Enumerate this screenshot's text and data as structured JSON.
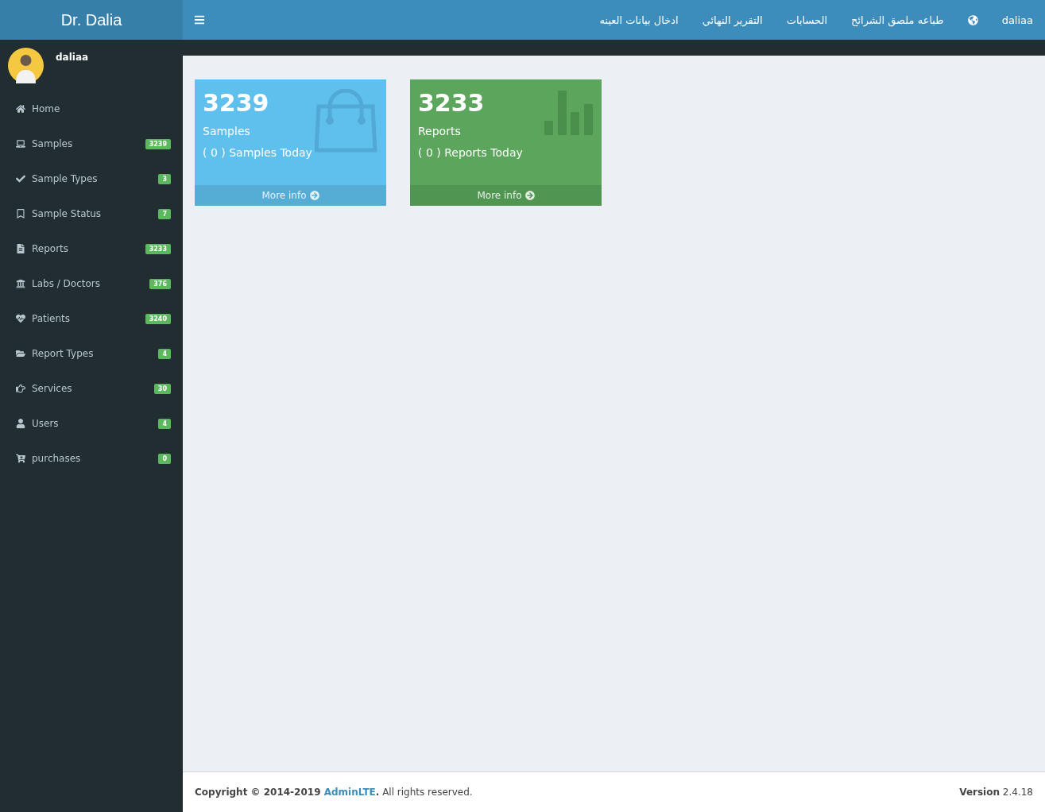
{
  "brand": "Dr. Dalia",
  "user": {
    "name": "daliaa"
  },
  "sidebar": {
    "items": [
      {
        "label": "Home"
      },
      {
        "label": "Samples",
        "badge": "3239"
      },
      {
        "label": "Sample Types",
        "badge": "3"
      },
      {
        "label": "Sample Status",
        "badge": "7"
      },
      {
        "label": "Reports",
        "badge": "3233"
      },
      {
        "label": "Labs / Doctors",
        "badge": "376"
      },
      {
        "label": "Patients",
        "badge": "3240"
      },
      {
        "label": "Report Types",
        "badge": "4"
      },
      {
        "label": "Services",
        "badge": "30"
      },
      {
        "label": "Users",
        "badge": "4"
      },
      {
        "label": "purchases",
        "badge": "0"
      }
    ]
  },
  "navbar": {
    "links": [
      "طباعه ملصق الشرائح",
      "الحسابات",
      "التقرير النهائي",
      "ادخال بيانات العينه"
    ],
    "user": "daliaa"
  },
  "cards": [
    {
      "kind": "bag",
      "color": "#5fc0ee",
      "count": "3239",
      "title": "Samples",
      "today": "( 0 ) Samples Today",
      "more": "More info"
    },
    {
      "kind": "chart",
      "color": "#5ba65c",
      "count": "3233",
      "title": "Reports",
      "today": "( 0 ) Reports Today",
      "more": "More info"
    }
  ],
  "footer": {
    "lead": "Copyright © 2014-2019 ",
    "link": "AdminLTE",
    "tail": "**.** All rights reserved.",
    "version": "**Version** 2.4.18"
  }
}
